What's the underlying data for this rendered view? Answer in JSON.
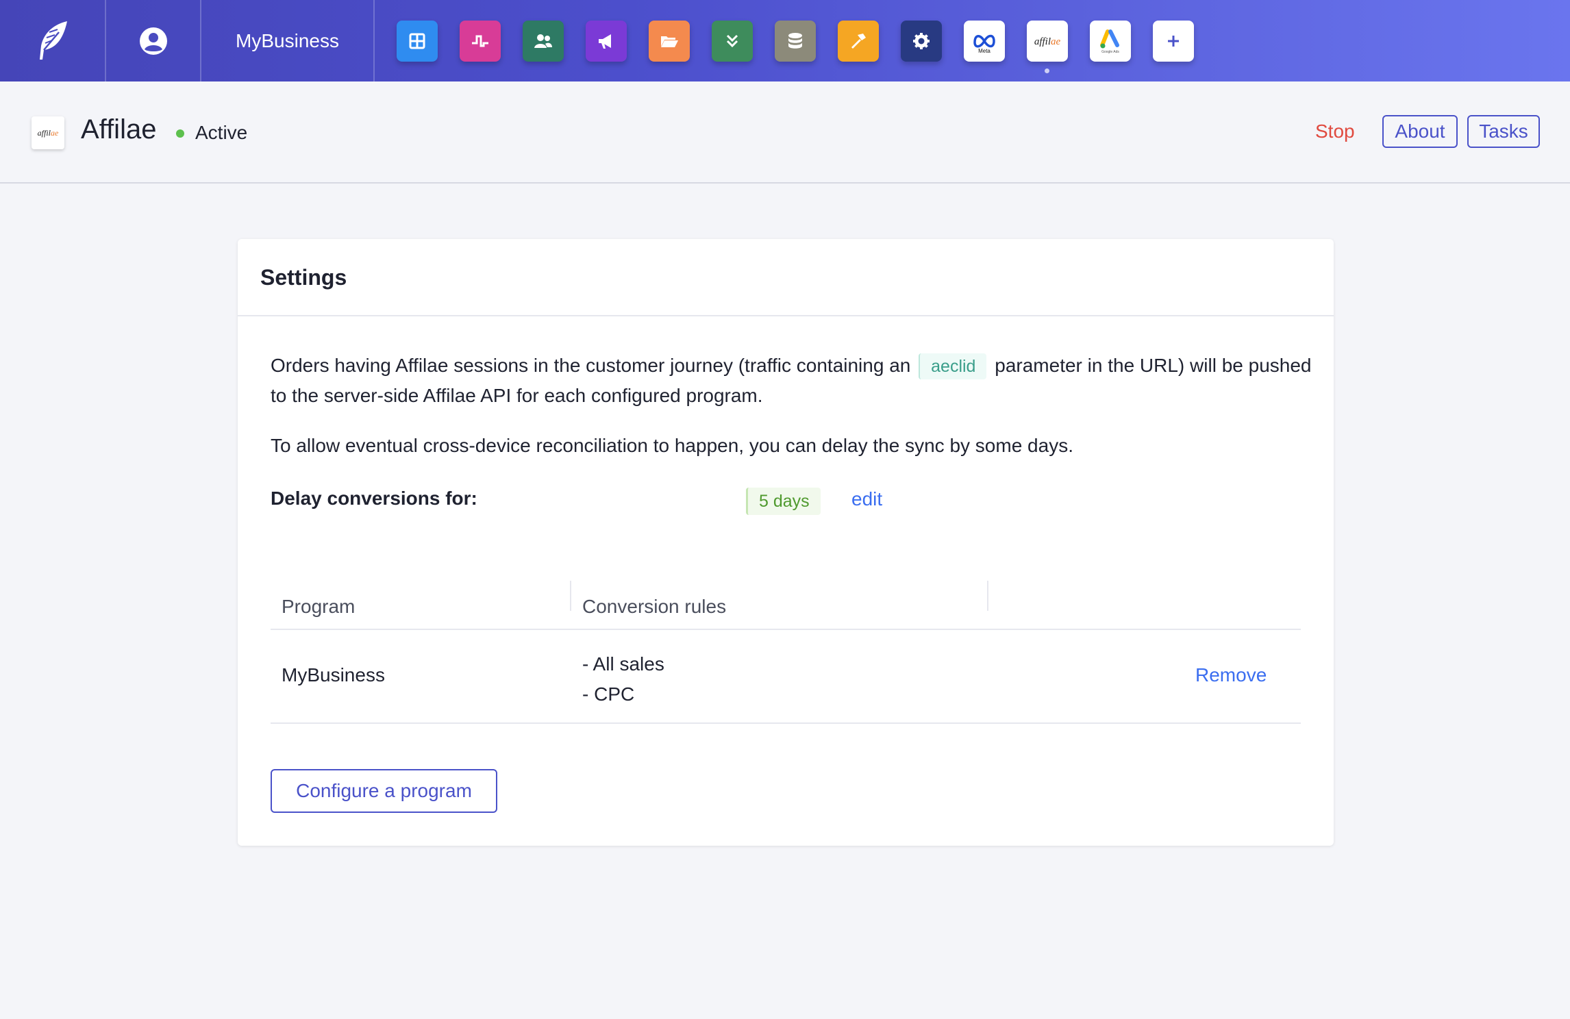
{
  "topbar": {
    "business_name": "MyBusiness",
    "apps": [
      {
        "icon": "dashboard-grid-icon",
        "color": "#2f8cf0"
      },
      {
        "icon": "pulse-icon",
        "color": "#d83c97"
      },
      {
        "icon": "users-icon",
        "color": "#2e7a64"
      },
      {
        "icon": "megaphone-icon",
        "color": "#7b3ad6"
      },
      {
        "icon": "folder-open-icon",
        "color": "#f48a4e"
      },
      {
        "icon": "double-chevron-down-icon",
        "color": "#3e8c5c"
      },
      {
        "icon": "database-icon",
        "color": "#8c8a7a"
      },
      {
        "icon": "hammer-icon",
        "color": "#f5a623"
      },
      {
        "icon": "gear-icon",
        "color": "#283a82"
      },
      {
        "icon": "meta-logo-icon",
        "label": "Meta"
      },
      {
        "icon": "affilae-logo-icon",
        "label": "affilae"
      },
      {
        "icon": "google-ads-logo-icon",
        "label": "Google Ads"
      },
      {
        "icon": "plus-icon"
      }
    ]
  },
  "header": {
    "title": "Affilae",
    "status": "Active",
    "stop_label": "Stop",
    "about_label": "About",
    "tasks_label": "Tasks"
  },
  "settings": {
    "title": "Settings",
    "para1_before": "Orders having Affilae sessions in the customer journey (traffic containing an",
    "para1_code": "aeclid",
    "para1_after": "parameter in the URL) will be pushed to the server-side Affilae API for each configured program.",
    "para2": "To allow eventual cross-device reconciliation to happen, you can delay the sync by some days.",
    "delay_label": "Delay conversions for:",
    "delay_value": "5 days",
    "edit_label": "edit",
    "table": {
      "headers": [
        "Program",
        "Conversion rules",
        ""
      ],
      "rows": [
        {
          "program": "MyBusiness",
          "rules": [
            "- All sales",
            "- CPC"
          ],
          "action": "Remove"
        }
      ]
    },
    "configure_label": "Configure a program"
  },
  "colors": {
    "accent": "#4a52c9",
    "link": "#3b6ef0",
    "stop": "#e04a3f",
    "status_active": "#5dc04e"
  }
}
